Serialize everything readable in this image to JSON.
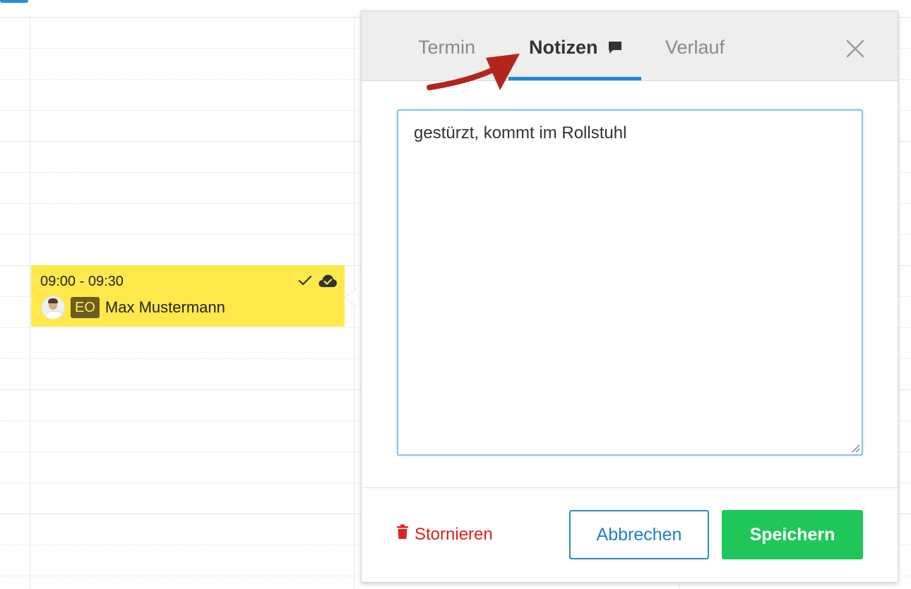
{
  "calendar": {
    "event": {
      "time_range": "09:00 - 09:30",
      "badge": "EO",
      "patient_name": "Max Mustermann",
      "background_color": "#ffe94a",
      "badge_color": "#6b5d1e",
      "icons": [
        "check-icon",
        "cloud-check-icon"
      ]
    }
  },
  "popup": {
    "tabs": [
      {
        "label": "Termin",
        "active": false
      },
      {
        "label": "Notizen",
        "active": true,
        "icon": "comment-icon"
      },
      {
        "label": "Verlauf",
        "active": false
      }
    ],
    "close_icon": "close-icon",
    "notes_value": "gestürzt, kommt im Rollstuhl",
    "footer": {
      "cancel_appointment_label": "Stornieren",
      "cancel_icon": "trash-icon",
      "abort_label": "Abbrechen",
      "save_label": "Speichern"
    }
  },
  "colors": {
    "accent_blue": "#1f88d6",
    "save_green": "#1fc75a",
    "danger_red": "#e0201b",
    "annotation_arrow": "#b3241b"
  }
}
